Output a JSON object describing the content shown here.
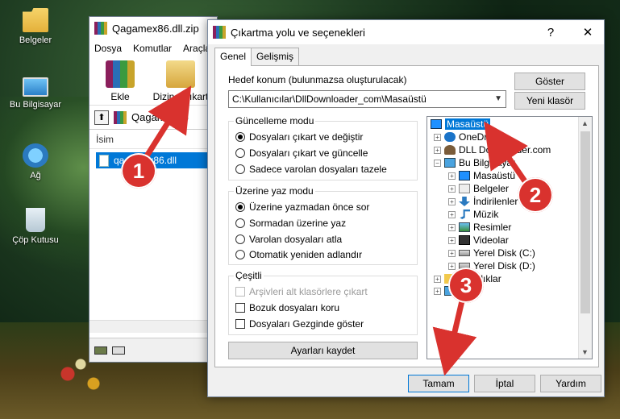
{
  "desktop": {
    "icons": [
      {
        "label": "Belgeler",
        "icon": "folder-icon"
      },
      {
        "label": "Bu Bilgisayar",
        "icon": "computer-icon"
      },
      {
        "label": "Ağ",
        "icon": "network-icon"
      },
      {
        "label": "Çöp Kutusu",
        "icon": "recycle-bin-icon"
      }
    ]
  },
  "winrar": {
    "title": "Qagamex86.dll.zip",
    "menu": [
      "Dosya",
      "Komutlar",
      "Araçla"
    ],
    "toolbar": {
      "add_label": "Ekle",
      "extract_label": "Dizine Çıkart"
    },
    "path": "Qagamex86",
    "column_name": "İsim",
    "file_row": "qagamex86.dll"
  },
  "dialog": {
    "title": "Çıkartma yolu ve seçenekleri",
    "help_button": "?",
    "close_button": "✕",
    "tabs": [
      "Genel",
      "Gelişmiş"
    ],
    "destination_label": "Hedef konum (bulunmazsa oluşturulacak)",
    "destination_value": "C:\\Kullanıcılar\\DllDownloader_com\\Masaüstü",
    "show_button": "Göster",
    "new_folder_button": "Yeni klasör",
    "update_mode": {
      "title": "Güncelleme modu",
      "options": [
        "Dosyaları çıkart ve değiştir",
        "Dosyaları çıkart ve güncelle",
        "Sadece varolan dosyaları tazele"
      ],
      "selected": 0
    },
    "overwrite_mode": {
      "title": "Üzerine yaz modu",
      "options": [
        "Üzerine yazmadan önce sor",
        "Sormadan üzerine yaz",
        "Varolan dosyaları atla",
        "Otomatik yeniden adlandır"
      ],
      "selected": 0
    },
    "misc": {
      "title": "Çeşitli",
      "options": [
        "Arşivleri alt klasörlere çıkart",
        "Bozuk dosyaları koru",
        "Dosyaları Gezginde göster"
      ],
      "disabled": [
        true,
        false,
        false
      ]
    },
    "save_settings_button": "Ayarları kaydet",
    "tree": [
      {
        "label": "Masaüstü",
        "icon": "desktop-icon",
        "selected": true
      },
      {
        "label": "OneDrive",
        "icon": "onedrive-icon"
      },
      {
        "label": "DLL Downloader.com",
        "icon": "user-icon"
      },
      {
        "label": "Bu Bilgisayar",
        "icon": "computer-icon"
      },
      {
        "label": "Masaüstü",
        "icon": "desktop-icon"
      },
      {
        "label": "Belgeler",
        "icon": "document-icon"
      },
      {
        "label": "İndirilenler",
        "icon": "download-icon"
      },
      {
        "label": "Müzik",
        "icon": "music-icon"
      },
      {
        "label": "Resimler",
        "icon": "pictures-icon"
      },
      {
        "label": "Videolar",
        "icon": "video-icon"
      },
      {
        "label": "Yerel Disk (C:)",
        "icon": "disk-icon"
      },
      {
        "label": "Yerel Disk (D:)",
        "icon": "disk-icon"
      },
      {
        "label": "Kitaplıklar",
        "icon": "folder-icon"
      },
      {
        "label": "",
        "icon": "network-icon"
      }
    ],
    "ok_button": "Tamam",
    "cancel_button": "İptal",
    "help_bottom_button": "Yardım"
  },
  "callouts": [
    "1",
    "2",
    "3"
  ],
  "colors": {
    "callout": "#d9322e",
    "selection": "#0078d7"
  }
}
